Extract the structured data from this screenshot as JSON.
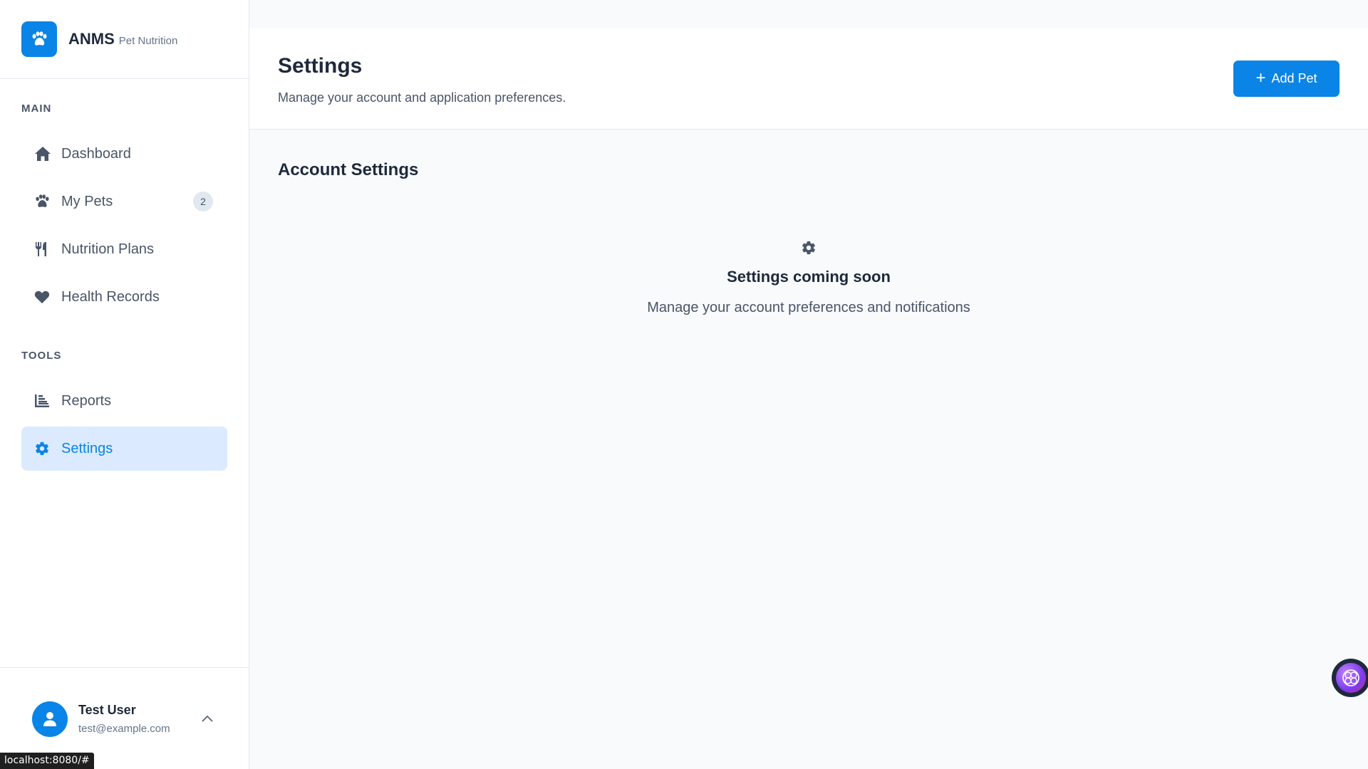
{
  "brand": {
    "name": "ANMS",
    "subtitle": "Pet Nutrition",
    "logo_icon": "paw-icon",
    "color": "#0a84e6"
  },
  "sidebar": {
    "sections": [
      {
        "title": "MAIN"
      },
      {
        "title": "TOOLS"
      }
    ],
    "items": [
      {
        "label": "Dashboard",
        "icon": "home-icon"
      },
      {
        "label": "My Pets",
        "icon": "paw-icon",
        "badge": "2"
      },
      {
        "label": "Nutrition Plans",
        "icon": "utensils-icon"
      },
      {
        "label": "Health Records",
        "icon": "heart-icon"
      },
      {
        "label": "Reports",
        "icon": "chart-icon"
      },
      {
        "label": "Settings",
        "icon": "gear-icon",
        "active": true
      }
    ]
  },
  "user": {
    "name": "Test User",
    "email": "test@example.com",
    "avatar_icon": "user-icon"
  },
  "header": {
    "title": "Settings",
    "subtitle": "Manage your account and application preferences.",
    "add_button_label": "Add Pet"
  },
  "main": {
    "section_title": "Account Settings",
    "empty_title": "Settings coming soon",
    "empty_text": "Manage your account preferences and notifications"
  },
  "status_bar": {
    "url": "localhost:8080/#"
  },
  "colors": {
    "accent": "#0a84e6",
    "active_bg": "#dbeafe",
    "text": "#1e293b",
    "muted": "#4a5568"
  }
}
